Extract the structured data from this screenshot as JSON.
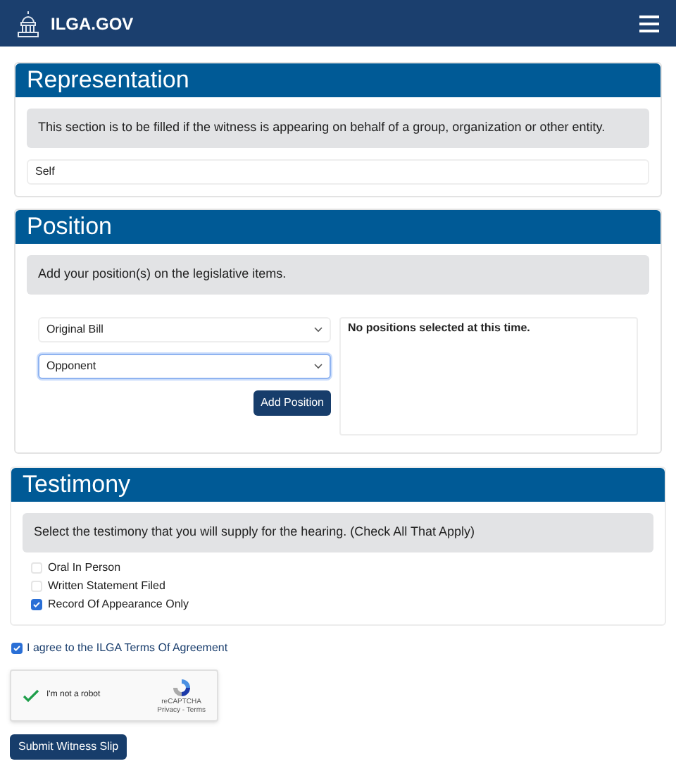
{
  "header": {
    "site_name": "ILGA.GOV"
  },
  "representation": {
    "title": "Representation",
    "notice": "This section is to be filled if the witness is appearing on behalf of a group, organization or other entity.",
    "value": "Self"
  },
  "position": {
    "title": "Position",
    "notice": "Add your position(s) on the legislative items.",
    "selects": [
      {
        "value": "Original Bill",
        "focused": false
      },
      {
        "value": "Opponent",
        "focused": true
      }
    ],
    "add_button": "Add Position",
    "empty_message": "No positions selected at this time."
  },
  "testimony": {
    "title": "Testimony",
    "notice": "Select the testimony that you will supply for the hearing. (Check All That Apply)",
    "options": [
      {
        "label": "Oral In Person",
        "checked": false
      },
      {
        "label": "Written Statement Filed",
        "checked": false
      },
      {
        "label": "Record Of Appearance Only",
        "checked": true
      }
    ]
  },
  "agreement": {
    "label": "I agree to the ILGA Terms Of Agreement",
    "checked": true
  },
  "captcha": {
    "label": "I'm not a robot",
    "checked": true,
    "brand": "reCAPTCHA",
    "links": "Privacy - Terms"
  },
  "submit_button": "Submit Witness Slip"
}
